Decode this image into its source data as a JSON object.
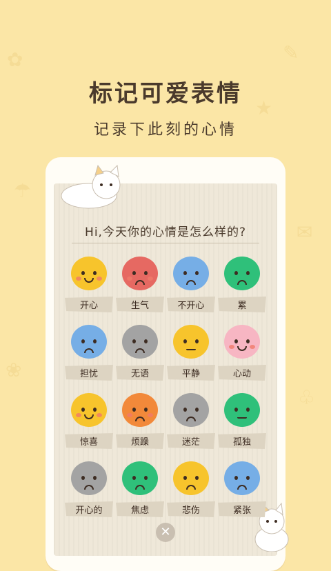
{
  "headline": "标记可爱表情",
  "subline": "记录下此刻的心情",
  "question": "Hi,今天你的心情是怎么样的?",
  "close_icon": "close-icon",
  "moods": [
    {
      "label": "开心",
      "color": "#f7c42c",
      "mouth": "smile",
      "blush": true
    },
    {
      "label": "生气",
      "color": "#e66962",
      "mouth": "sad",
      "blush": true
    },
    {
      "label": "不开心",
      "color": "#76aee6",
      "mouth": "sad",
      "blush": false
    },
    {
      "label": "累",
      "color": "#2fc07a",
      "mouth": "sad",
      "blush": false
    },
    {
      "label": "担忧",
      "color": "#76aee6",
      "mouth": "sad",
      "blush": false
    },
    {
      "label": "无语",
      "color": "#a3a3a3",
      "mouth": "sad",
      "blush": false
    },
    {
      "label": "平静",
      "color": "#f7c42c",
      "mouth": "flat",
      "blush": false
    },
    {
      "label": "心动",
      "color": "#f7b6c3",
      "mouth": "smile",
      "blush": true
    },
    {
      "label": "惊喜",
      "color": "#f7c42c",
      "mouth": "smile",
      "blush": true
    },
    {
      "label": "烦躁",
      "color": "#f2893a",
      "mouth": "sad",
      "blush": true
    },
    {
      "label": "迷茫",
      "color": "#a3a3a3",
      "mouth": "sad",
      "blush": false
    },
    {
      "label": "孤独",
      "color": "#2fc07a",
      "mouth": "flat",
      "blush": false
    },
    {
      "label": "开心的",
      "color": "#a3a3a3",
      "mouth": "sad",
      "blush": false
    },
    {
      "label": "焦虑",
      "color": "#2fc07a",
      "mouth": "sad",
      "blush": false
    },
    {
      "label": "悲伤",
      "color": "#f7c42c",
      "mouth": "sad",
      "blush": false
    },
    {
      "label": "紧张",
      "color": "#76aee6",
      "mouth": "sad",
      "blush": false
    }
  ]
}
